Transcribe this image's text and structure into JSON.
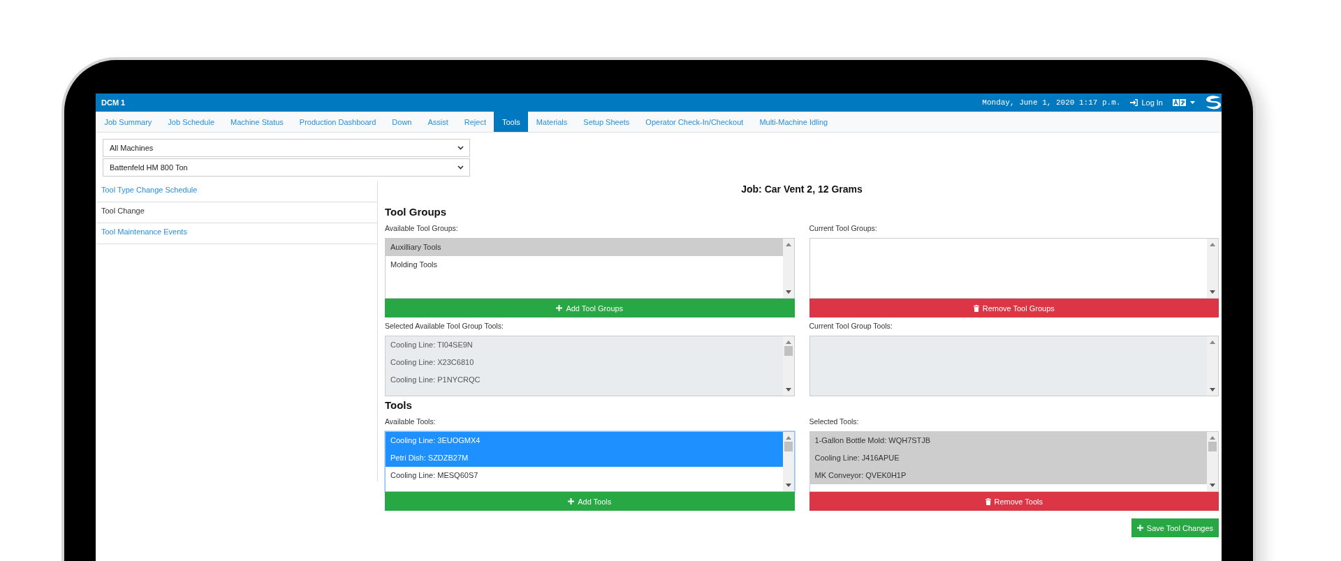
{
  "app": {
    "title": "DCM 1",
    "datetime": "Monday, June 1, 2020 1:17 p.m.",
    "login": "Log In"
  },
  "nav_tabs": [
    {
      "label": "Job Summary",
      "selected": false
    },
    {
      "label": "Job Schedule",
      "selected": false
    },
    {
      "label": "Machine Status",
      "selected": false
    },
    {
      "label": "Production Dashboard",
      "selected": false
    },
    {
      "label": "Down",
      "selected": false
    },
    {
      "label": "Assist",
      "selected": false
    },
    {
      "label": "Reject",
      "selected": false
    },
    {
      "label": "Tools",
      "selected": true
    },
    {
      "label": "Materials",
      "selected": false
    },
    {
      "label": "Setup Sheets",
      "selected": false
    },
    {
      "label": "Operator Check-In/Checkout",
      "selected": false
    },
    {
      "label": "Multi-Machine Idling",
      "selected": false
    }
  ],
  "filters": [
    {
      "value": "All Machines"
    },
    {
      "value": "Battenfeld HM 800 Ton"
    }
  ],
  "sidebar": {
    "items": [
      {
        "label": "Tool Type Change Schedule",
        "selected": false
      },
      {
        "label": "Tool Change",
        "selected": true
      },
      {
        "label": "Tool Maintenance Events",
        "selected": false
      }
    ]
  },
  "job_title": "Job: Car Vent 2, 12 Grams",
  "sections": [
    {
      "heading": "Tool Groups",
      "rows": [
        [
          {
            "label": "Available Tool Groups:",
            "disabled": false,
            "focused": false,
            "items": [
              {
                "text": "Auxilliary Tools",
                "selected": true
              },
              {
                "text": "Molding Tools",
                "selected": false
              }
            ],
            "button": {
              "label": "Add Tool Groups",
              "kind": "add"
            }
          },
          {
            "label": "Current Tool Groups:",
            "disabled": false,
            "focused": false,
            "button": {
              "label": "Remove Tool Groups",
              "kind": "remove"
            }
          }
        ],
        [
          {
            "label": "Selected Available Tool Group Tools:",
            "disabled": true,
            "focused": false,
            "items": [
              {
                "text": "Cooling Line: TI04SE9N",
                "selected": false
              },
              {
                "text": "Cooling Line: X23C6810",
                "selected": false
              },
              {
                "text": "Cooling Line: P1NYCRQC",
                "selected": false
              }
            ]
          },
          {
            "label": "Current Tool Group Tools:",
            "disabled": true,
            "focused": false
          }
        ]
      ]
    },
    {
      "heading": "Tools",
      "rows": [
        [
          {
            "label": "Available Tools:",
            "disabled": false,
            "focused": true,
            "items": [
              {
                "text": "Cooling Line: 3EUOGMX4",
                "selected": true
              },
              {
                "text": "Petri Dish: SZDZB27M",
                "selected": true
              },
              {
                "text": "Cooling Line: MESQ60S7",
                "selected": false
              }
            ],
            "button": {
              "label": "Add Tools",
              "kind": "add"
            }
          },
          {
            "label": "Selected Tools:",
            "disabled": false,
            "focused": false,
            "items": [
              {
                "text": "1-Gallon Bottle Mold: WQH7STJB",
                "selected": true
              },
              {
                "text": "Cooling Line: J416APUE",
                "selected": true
              },
              {
                "text": "MK Conveyor: QVEK0H1P",
                "selected": true
              }
            ],
            "button": {
              "label": "Remove Tools",
              "kind": "remove"
            }
          }
        ]
      ]
    }
  ],
  "save_button": {
    "label": "Save Tool Changes",
    "kind": "add"
  }
}
